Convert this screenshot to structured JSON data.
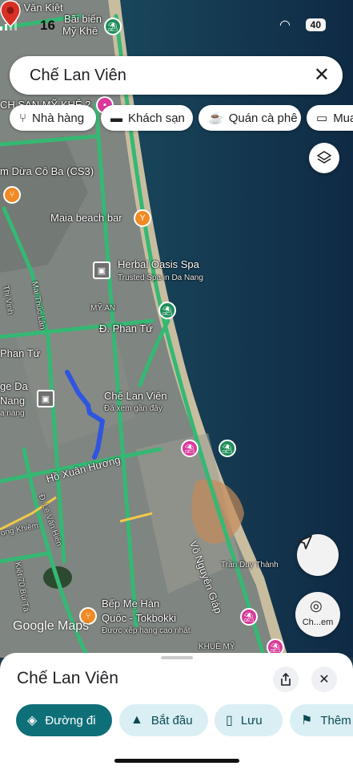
{
  "status_bar": {
    "time": "16",
    "battery": "40"
  },
  "search": {
    "value": "Chế Lan Viên",
    "clear_icon": "close-icon"
  },
  "chips": [
    {
      "label": "Nhà hàng",
      "icon": "restaurant-icon"
    },
    {
      "label": "Khách sạn",
      "icon": "hotel-icon"
    },
    {
      "label": "Quán cà phê",
      "icon": "cafe-icon"
    },
    {
      "label": "Mua",
      "icon": "shopping-icon"
    }
  ],
  "map": {
    "labels": {
      "bai_bien": "Bãi biển",
      "my_khe": "Mỹ Khê",
      "vo_van_kiet": "Võ Văn Kiệt",
      "ch_san_my_khe": "CH SAN MỸ KHÊ 2",
      "mam_dua": "m Dừa Cô Ba (CS3)",
      "maia": "Maia beach bar",
      "herbal": "Herbal Oasis Spa",
      "herbal_sub": "Trusted Spa in Da Nang",
      "my_an": "MỸ AN",
      "phan_tu_1": "Đ. Phan Tứ",
      "phan_tu_2": "Phan Tứ",
      "mai_thuc_lan": "Mai Thúc Lân",
      "thi_vinh": "Thị Vinh",
      "ge_da": "ge Da",
      "nang": "Nang",
      "da_nang": "a nang",
      "che_lan_vien": "Chế Lan Viên",
      "che_lan_vien_sub": "Đã xem gần đây",
      "ho_xuan_huong": "Hồ Xuân Hương",
      "le_van_hien": "Đ. Lê Văn Hiến",
      "ong_khiem": "ong Khiêm",
      "kiet_bui_ta": "Kiệt 70 Bùi Tá",
      "vo_nguyen_giap": "Võ Nguyên Giáp",
      "tran_duy_thanh": "Trần Duy Thành",
      "bep_me_han": "Bếp Mẹ Hàn",
      "quoc_tokbokki": "Quốc - Tokbokki",
      "duoc_xep_hang": "Được xếp hạng cao nhất",
      "khue_my": "KHUÊ MỸ"
    },
    "google_logo": "Google Maps",
    "lens_label": "Ch...em"
  },
  "sheet": {
    "title": "Chế Lan Viên",
    "share_icon": "share-icon",
    "close_icon": "close-icon",
    "actions": [
      {
        "label": "Đường đi",
        "icon": "directions-icon"
      },
      {
        "label": "Bắt đầu",
        "icon": "navigation-icon"
      },
      {
        "label": "Lưu",
        "icon": "bookmark-icon"
      },
      {
        "label": "Thêm",
        "icon": "flag-icon"
      }
    ]
  },
  "colors": {
    "accent": "#0f6f79",
    "accent_light": "#d9eff3",
    "road": "#3fbf7a",
    "pin": "#d93025",
    "route": "#2f55e0"
  }
}
